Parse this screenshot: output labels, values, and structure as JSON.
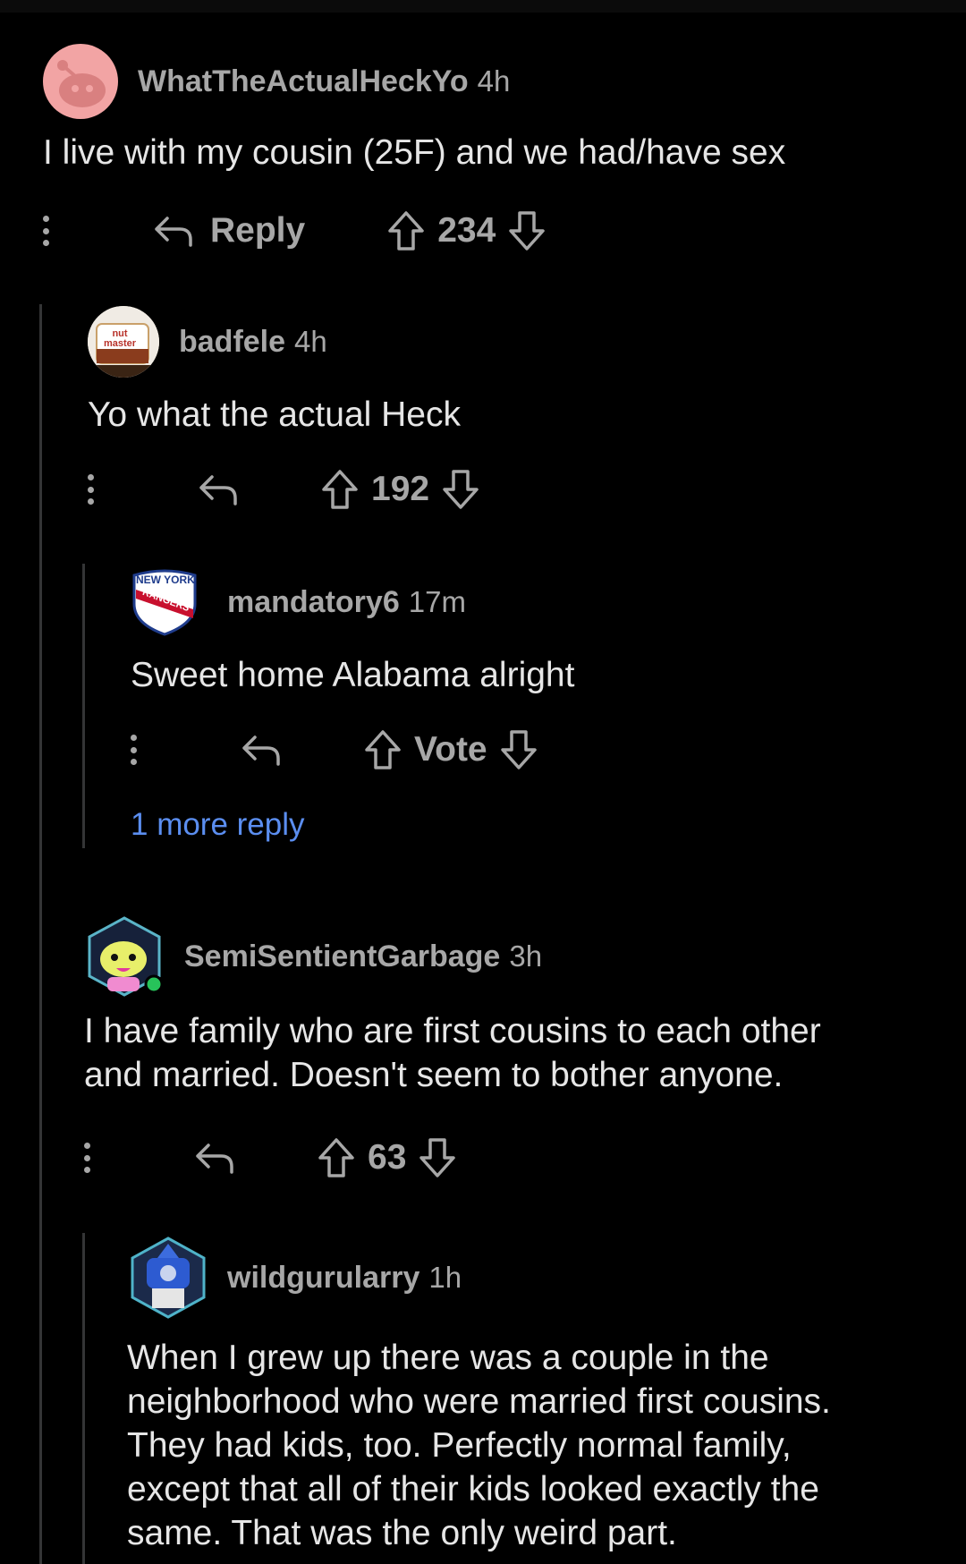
{
  "comments": [
    {
      "username": "WhatTheActualHeckYo",
      "age": "4h",
      "text": "I live with my cousin (25F) and we had/have sex",
      "reply_label": "Reply",
      "score": "234"
    },
    {
      "username": "badfele",
      "age": "4h",
      "text": "Yo what the actual Heck",
      "score": "192",
      "avatar_text": "nut master"
    },
    {
      "username": "mandatory6",
      "age": "17m",
      "text": "Sweet home Alabama alright",
      "score": "Vote",
      "avatar_text_top": "NEW YORK",
      "avatar_text_band": "RANGERS"
    },
    {
      "username": "SemiSentientGarbage",
      "age": "3h",
      "text_lines": [
        "I have family who are first cousins to each other",
        "and married. Doesn't seem to bother anyone."
      ],
      "score": "63"
    },
    {
      "username": "wildgurularry",
      "age": "1h",
      "text_lines": [
        "When I grew up there was a couple in the",
        "neighborhood who were married first cousins.",
        "They had kids, too.  Perfectly normal family,",
        "except that all of their kids looked exactly the",
        "same.  That was the only weird part."
      ]
    }
  ],
  "more_replies_label": "1 more reply",
  "icons": [
    "more-icon",
    "reply-icon",
    "upvote-icon",
    "downvote-icon"
  ],
  "colors": {
    "background": "#000000",
    "username": "#a7a7a7",
    "body_text": "#e6e6e6",
    "link": "#5b8ef0",
    "thread_line": "#343536",
    "default_avatar": "#f2a4a4"
  }
}
